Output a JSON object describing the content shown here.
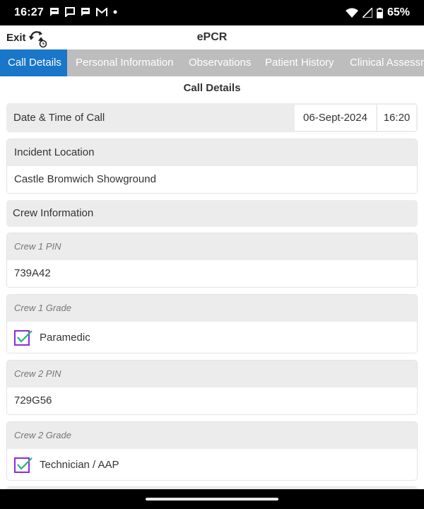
{
  "status_bar": {
    "time": "16:27",
    "battery": "65%",
    "notification_icons": [
      "chat-bubble-icon",
      "chat-bubble-icon",
      "chat-bubble-icon",
      "gmail-icon",
      "dot-icon"
    ],
    "system_icons": [
      "wifi-icon",
      "cell-signal-icon",
      "battery-icon"
    ]
  },
  "header": {
    "exit_label": "Exit",
    "title": "ePCR",
    "sync_icon": "sync-clock-icon"
  },
  "tabs": [
    {
      "label": "Call Details",
      "active": true
    },
    {
      "label": "Personal Information",
      "active": false
    },
    {
      "label": "Observations",
      "active": false
    },
    {
      "label": "Patient History",
      "active": false
    },
    {
      "label": "Clinical Assessm",
      "active": false
    }
  ],
  "section_title": "Call Details",
  "date_time": {
    "label": "Date & Time of Call",
    "date": "06-Sept-2024",
    "time": "16:20"
  },
  "incident": {
    "label": "Incident Location",
    "value": "Castle Bromwich Showground"
  },
  "crew_information_label": "Crew Information",
  "crew1_pin": {
    "label": "Crew 1 PIN",
    "value": "739A42"
  },
  "crew1_grade": {
    "label": "Crew 1 Grade",
    "value": "Paramedic"
  },
  "crew2_pin": {
    "label": "Crew 2 PIN",
    "value": "729G56"
  },
  "crew2_grade": {
    "label": "Crew 2 Grade",
    "value": "Technician / AAP"
  },
  "colors": {
    "tab_active": "#1976c9",
    "tab_bar": "#bdbdbd",
    "checkbox": "#8a2be2",
    "check_mark": "#2ab573"
  }
}
